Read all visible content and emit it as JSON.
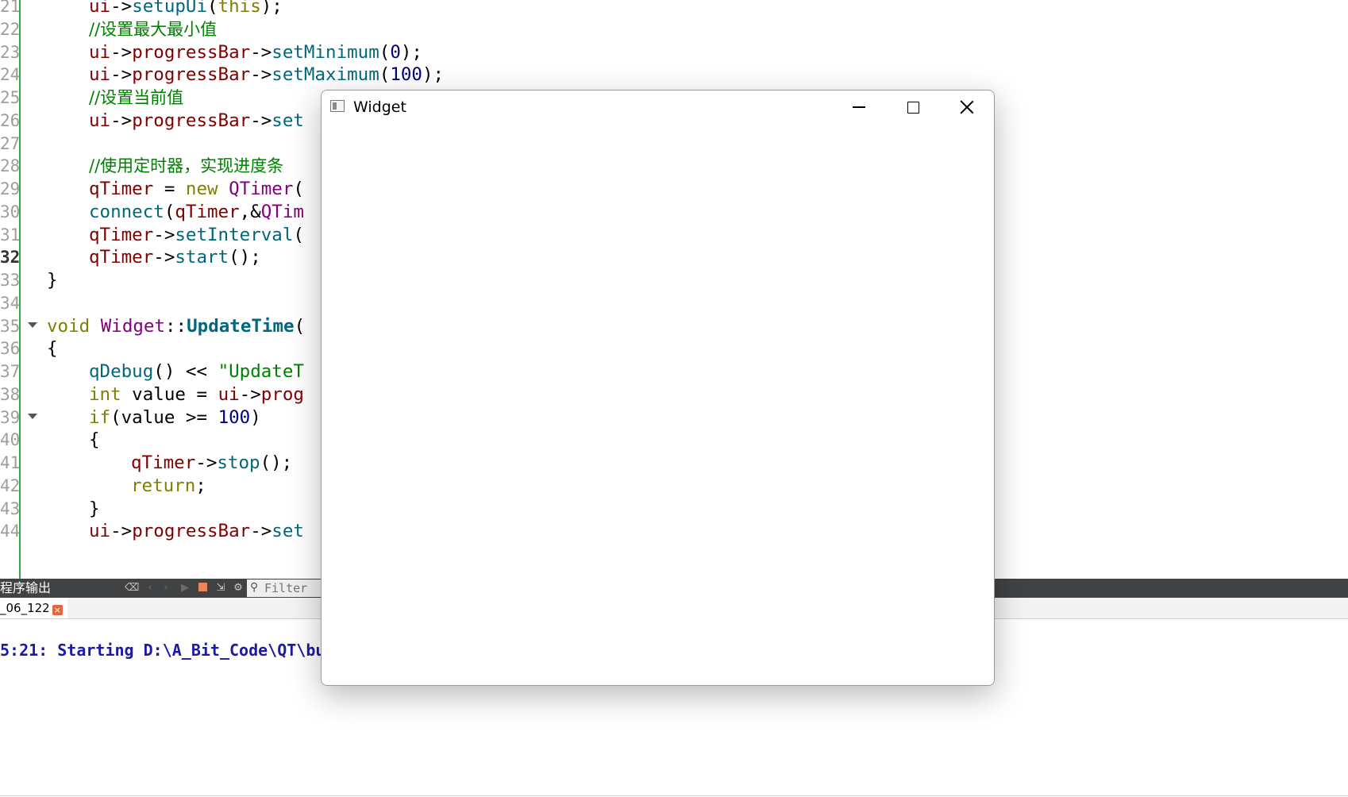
{
  "editor": {
    "lines": [
      {
        "num": "21",
        "tokens": [
          {
            "t": "ui",
            "c": "v"
          },
          {
            "t": "->"
          },
          {
            "t": "setupUi",
            "c": "m"
          },
          {
            "t": "("
          },
          {
            "t": "this",
            "c": "k"
          },
          {
            "t": ");"
          }
        ]
      },
      {
        "num": "22",
        "tokens": [
          {
            "t": "//设置最大最小值",
            "c": "c"
          }
        ]
      },
      {
        "num": "23",
        "tokens": [
          {
            "t": "ui",
            "c": "v"
          },
          {
            "t": "->"
          },
          {
            "t": "progressBar",
            "c": "v"
          },
          {
            "t": "->"
          },
          {
            "t": "setMinimum",
            "c": "m"
          },
          {
            "t": "("
          },
          {
            "t": "0",
            "c": "n"
          },
          {
            "t": ");"
          }
        ]
      },
      {
        "num": "24",
        "tokens": [
          {
            "t": "ui",
            "c": "v"
          },
          {
            "t": "->"
          },
          {
            "t": "progressBar",
            "c": "v"
          },
          {
            "t": "->"
          },
          {
            "t": "setMaximum",
            "c": "m"
          },
          {
            "t": "("
          },
          {
            "t": "100",
            "c": "n"
          },
          {
            "t": ");"
          }
        ]
      },
      {
        "num": "25",
        "tokens": [
          {
            "t": "//设置当前值",
            "c": "c"
          }
        ]
      },
      {
        "num": "26",
        "tokens": [
          {
            "t": "ui",
            "c": "v"
          },
          {
            "t": "->"
          },
          {
            "t": "progressBar",
            "c": "v"
          },
          {
            "t": "->"
          },
          {
            "t": "set",
            "c": "m"
          }
        ]
      },
      {
        "num": "27",
        "tokens": []
      },
      {
        "num": "28",
        "tokens": [
          {
            "t": "//使用定时器，实现进度条",
            "c": "c"
          }
        ]
      },
      {
        "num": "29",
        "tokens": [
          {
            "t": "qTimer",
            "c": "v"
          },
          {
            "t": " = "
          },
          {
            "t": "new",
            "c": "k"
          },
          {
            "t": " "
          },
          {
            "t": "QTimer",
            "c": "t"
          },
          {
            "t": "("
          }
        ]
      },
      {
        "num": "30",
        "tokens": [
          {
            "t": "connect",
            "c": "m"
          },
          {
            "t": "("
          },
          {
            "t": "qTimer",
            "c": "v"
          },
          {
            "t": ",&"
          },
          {
            "t": "QTim",
            "c": "t"
          }
        ]
      },
      {
        "num": "31",
        "tokens": [
          {
            "t": "qTimer",
            "c": "v"
          },
          {
            "t": "->"
          },
          {
            "t": "setInterval",
            "c": "m"
          },
          {
            "t": "("
          }
        ]
      },
      {
        "num": "32",
        "tokens": [
          {
            "t": "qTimer",
            "c": "v"
          },
          {
            "t": "->"
          },
          {
            "t": "start",
            "c": "m"
          },
          {
            "t": "();"
          }
        ]
      },
      {
        "num": "33",
        "tokens": [
          {
            "t": "}"
          }
        ]
      },
      {
        "num": "34",
        "tokens": []
      },
      {
        "num": "35",
        "tokens": [
          {
            "t": "void",
            "c": "k"
          },
          {
            "t": " "
          },
          {
            "t": "Widget",
            "c": "t"
          },
          {
            "t": "::"
          },
          {
            "t": "UpdateTime",
            "c": "f"
          },
          {
            "t": "("
          }
        ]
      },
      {
        "num": "36",
        "tokens": [
          {
            "t": "{"
          }
        ]
      },
      {
        "num": "37",
        "tokens": [
          {
            "t": "qDebug",
            "c": "m"
          },
          {
            "t": "() << "
          },
          {
            "t": "\"UpdateT",
            "c": "s"
          }
        ]
      },
      {
        "num": "38",
        "tokens": [
          {
            "t": "int",
            "c": "k"
          },
          {
            "t": " value = "
          },
          {
            "t": "ui",
            "c": "v"
          },
          {
            "t": "->"
          },
          {
            "t": "prog",
            "c": "v"
          }
        ]
      },
      {
        "num": "39",
        "tokens": [
          {
            "t": "if",
            "c": "k"
          },
          {
            "t": "(value >= "
          },
          {
            "t": "100",
            "c": "n"
          },
          {
            "t": ")"
          }
        ]
      },
      {
        "num": "40",
        "tokens": [
          {
            "t": "{"
          }
        ]
      },
      {
        "num": "41",
        "tokens": [
          {
            "t": "qTimer",
            "c": "v"
          },
          {
            "t": "->"
          },
          {
            "t": "stop",
            "c": "m"
          },
          {
            "t": "();"
          }
        ]
      },
      {
        "num": "42",
        "tokens": [
          {
            "t": "return",
            "c": "k"
          },
          {
            "t": ";"
          }
        ]
      },
      {
        "num": "43",
        "tokens": [
          {
            "t": "}"
          }
        ]
      },
      {
        "num": "44",
        "tokens": [
          {
            "t": "ui",
            "c": "v"
          },
          {
            "t": "->"
          },
          {
            "t": "progressBar",
            "c": "v"
          },
          {
            "t": "->"
          },
          {
            "t": "set",
            "c": "m"
          }
        ]
      }
    ]
  },
  "output_pane": {
    "title": "程序输出",
    "filter_placeholder": "Filter",
    "tab_label": "_06_122",
    "output_line": "5:21: Starting D:\\A_Bit_Code\\QT\\bu"
  },
  "widget_window": {
    "title": "Widget"
  }
}
